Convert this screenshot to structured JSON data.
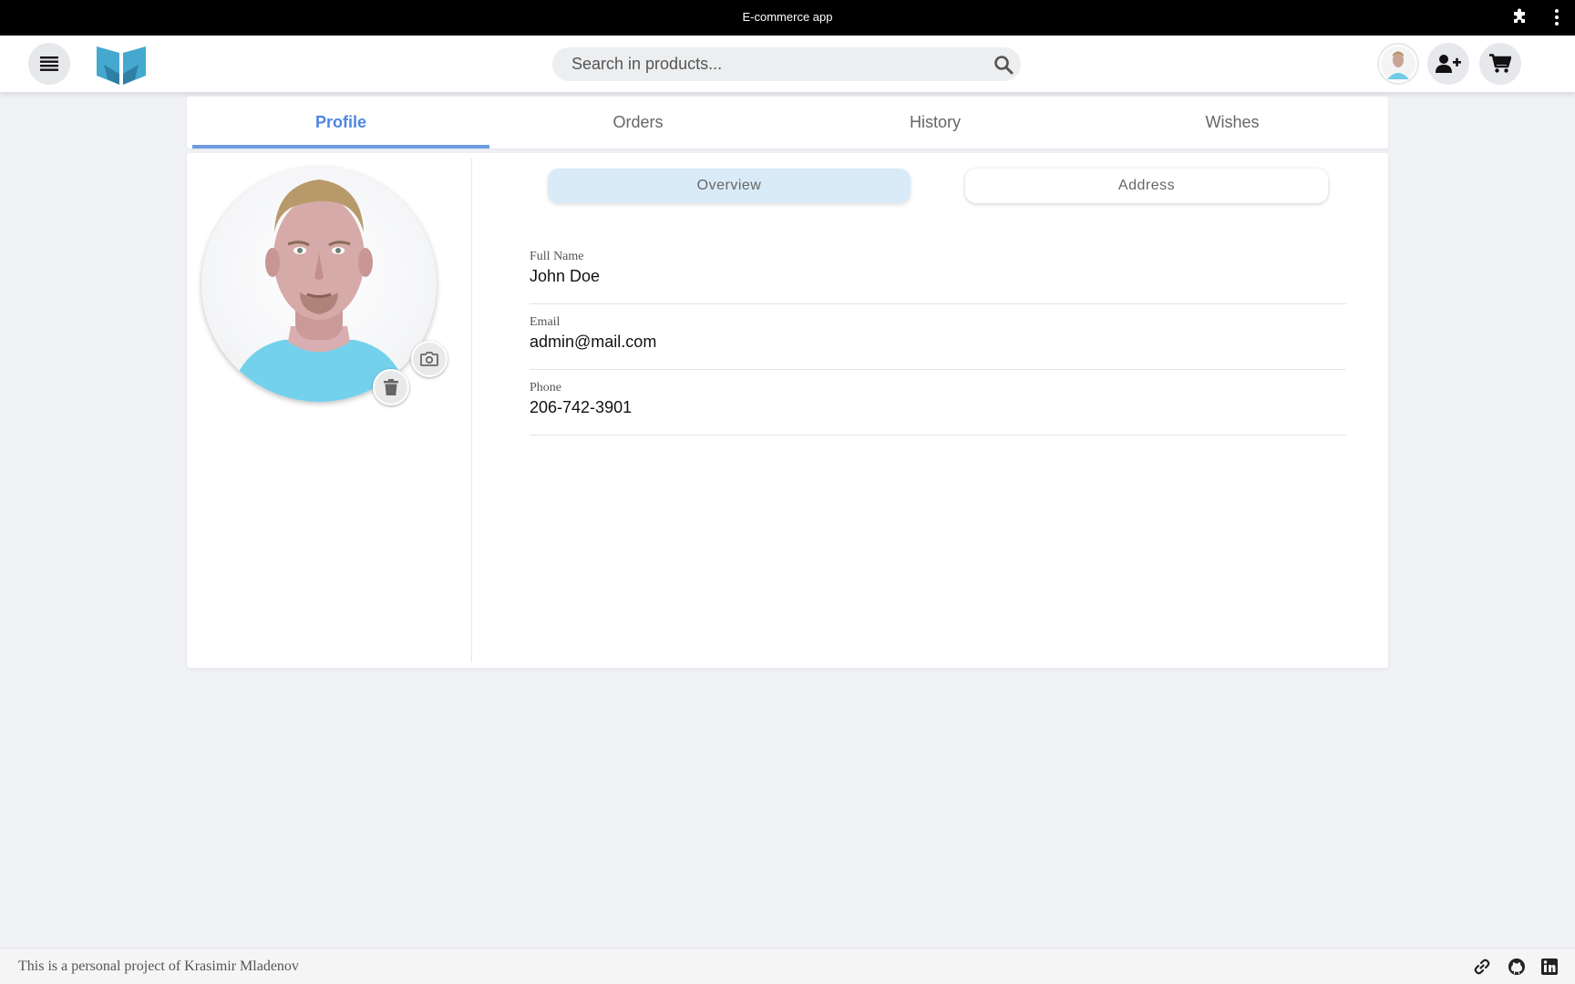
{
  "window": {
    "title": "E-commerce app",
    "icons": [
      "puzzle-icon",
      "more-vert-icon"
    ]
  },
  "header": {
    "menu_icon": "hamburger-icon",
    "logo_icon": "butterfly-book-logo",
    "search": {
      "placeholder": "Search in products...",
      "value": "",
      "icon": "search-icon"
    },
    "actions": [
      "avatar",
      "add-user-icon",
      "cart-icon"
    ]
  },
  "tabs": [
    {
      "label": "Profile",
      "active": true
    },
    {
      "label": "Orders",
      "active": false
    },
    {
      "label": "History",
      "active": false
    },
    {
      "label": "Wishes",
      "active": false
    }
  ],
  "profile": {
    "photo_actions": [
      "camera-icon",
      "trash-icon"
    ],
    "segments": {
      "overview": "Overview",
      "address": "Address",
      "selected": "Overview"
    },
    "fields": {
      "name": {
        "label": "Full Name",
        "value": "John Doe"
      },
      "email": {
        "label": "Email",
        "value": "admin@mail.com"
      },
      "phone": {
        "label": "Phone",
        "value": "206-742-3901"
      }
    }
  },
  "footer": {
    "text": "This is a personal project of Krasimir Mladenov",
    "icons": [
      "link-icon",
      "github-icon",
      "linkedin-icon"
    ]
  },
  "colors": {
    "accent": "#4f86e0",
    "tab_underline": "#6e9be2",
    "segment_active": "#d9ebf7",
    "logo_primary": "#44a8cf",
    "logo_dark": "#2f7fa5",
    "page_bg": "#eff1f5"
  }
}
